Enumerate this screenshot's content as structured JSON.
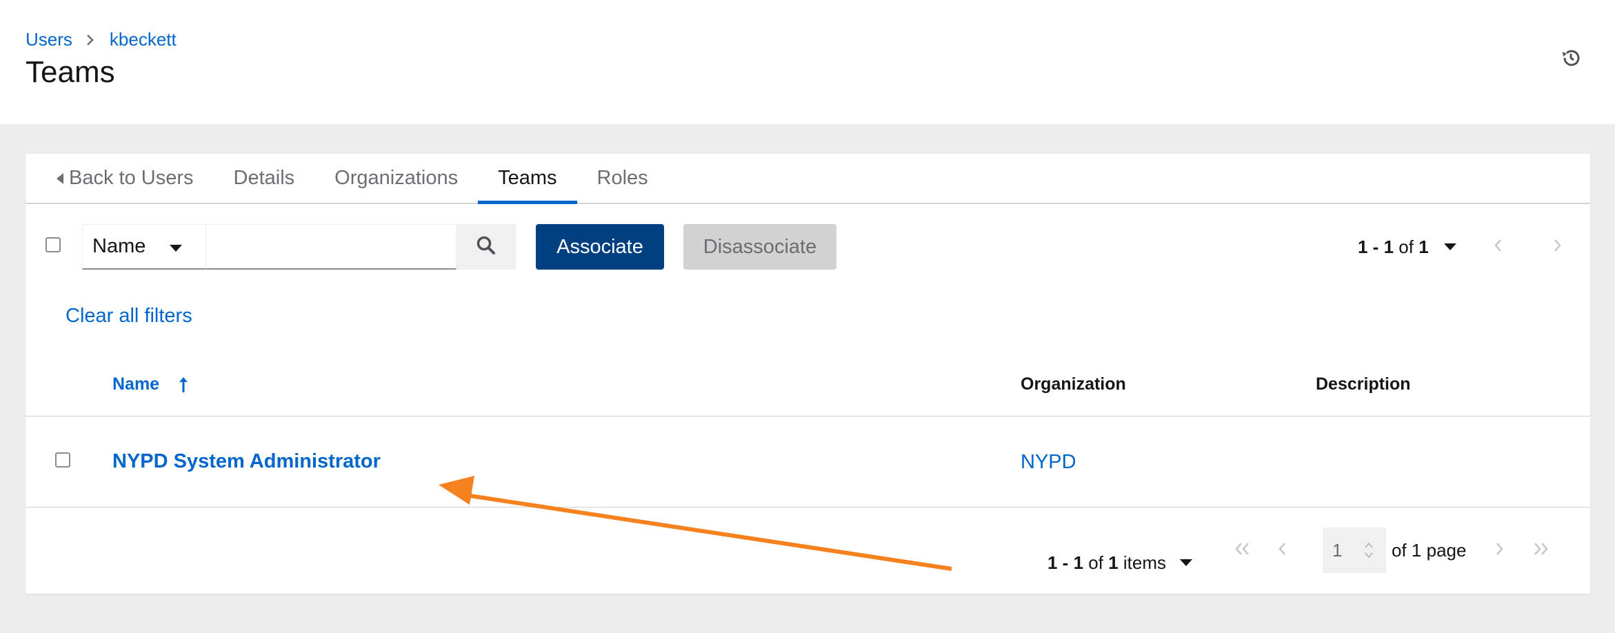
{
  "breadcrumb": {
    "users": "Users",
    "user": "kbeckett"
  },
  "page": {
    "title": "Teams"
  },
  "tabs": [
    {
      "label": "Back to Users"
    },
    {
      "label": "Details"
    },
    {
      "label": "Organizations"
    },
    {
      "label": "Teams",
      "active": true
    },
    {
      "label": "Roles"
    }
  ],
  "toolbar": {
    "filter_type": "Name",
    "search_value": "",
    "associate_label": "Associate",
    "disassociate_label": "Disassociate",
    "pager_range": "1 - 1",
    "pager_of": "of",
    "pager_total": "1"
  },
  "clear_filters": "Clear all filters",
  "table": {
    "columns": {
      "name": "Name",
      "organization": "Organization",
      "description": "Description"
    },
    "rows": [
      {
        "name": "NYPD System Administrator",
        "organization": "NYPD",
        "description": ""
      }
    ]
  },
  "pagination": {
    "range": "1 - 1",
    "of": "of",
    "total": "1",
    "items": "items",
    "page": "1",
    "of_pages_prefix": "of",
    "pages": "1",
    "page_word": "page"
  },
  "colors": {
    "link": "#0066cc",
    "primary_button": "#004080",
    "annotation_arrow": "#f5821f"
  },
  "icons": [
    "angle-right-icon",
    "history-icon",
    "caret-left-icon",
    "caret-down-icon",
    "search-icon",
    "angle-left-icon",
    "long-arrow-up-icon",
    "angle-double-left-icon",
    "angle-double-right-icon",
    "spinner-arrows-icon"
  ]
}
